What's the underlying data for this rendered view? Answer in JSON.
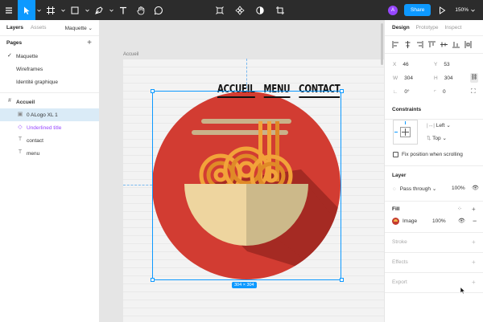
{
  "toolbar": {
    "tools": [
      "figma-menu-icon",
      "move-tool-icon",
      "frame-tool-icon",
      "shape-tool-icon",
      "pen-tool-icon",
      "text-tool-icon",
      "hand-tool-icon",
      "comment-tool-icon"
    ],
    "center_tools": [
      "component-icon",
      "plugin-icon",
      "contrast-icon",
      "crop-icon"
    ],
    "avatar_initial": "A",
    "share_label": "Share",
    "zoom": "150%"
  },
  "left_panel": {
    "tabs": [
      "Layers",
      "Assets"
    ],
    "page_select": "Maquette",
    "pages_title": "Pages",
    "pages": [
      {
        "label": "Maquette",
        "current": true
      },
      {
        "label": "Wireframes",
        "current": false
      },
      {
        "label": "Identité graphique",
        "current": false
      }
    ],
    "frame_name": "Accueil",
    "layers": [
      {
        "label": "0 ALogo XL 1",
        "icon": "image-icon",
        "selected": true
      },
      {
        "label": "Underlined title",
        "icon": "component-icon",
        "selected": false
      },
      {
        "label": "contact",
        "icon": "text-icon",
        "selected": false
      },
      {
        "label": "menu",
        "icon": "text-icon",
        "selected": false
      }
    ]
  },
  "canvas": {
    "frame_label": "Accueil",
    "nav": [
      "ACCUEIL",
      "MENU",
      "CONTACT"
    ],
    "dimensions_badge": "304 × 304",
    "logo_colors": {
      "circle": "#d23c32",
      "shadow": "#a52a23",
      "bowl_left": "#eed59f",
      "bowl_right": "#ccb98a",
      "noodles": "#f2a33a",
      "noodles_dark": "#e08a27",
      "chopsticks": "#c9b28a"
    }
  },
  "right_panel": {
    "tabs": [
      "Design",
      "Prototype",
      "Inspect"
    ],
    "x": "46",
    "y": "53",
    "w": "304",
    "h": "304",
    "rotation": "0°",
    "radius": "0",
    "labels": {
      "x": "X",
      "y": "Y",
      "w": "W",
      "h": "H"
    },
    "constraints_title": "Constraints",
    "constraint_h": "Left",
    "constraint_v": "Top",
    "fix_position_label": "Fix position when scrolling",
    "layer_title": "Layer",
    "blend_mode": "Pass through",
    "layer_opacity": "100%",
    "fill_title": "Fill",
    "fill_type": "Image",
    "fill_opacity": "100%",
    "stroke_title": "Stroke",
    "effects_title": "Effects",
    "export_title": "Export"
  },
  "colors": {
    "accent": "#0d99ff",
    "toolbar_bg": "#2c2c2c",
    "component_purple": "#9747ff"
  }
}
